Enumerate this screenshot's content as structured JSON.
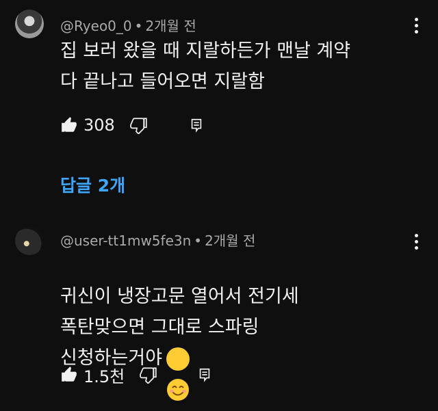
{
  "comments": [
    {
      "author": "@Ryeo0_0",
      "separator": "•",
      "time": "2개월 전",
      "text": "집 보러 왔을 때 지랄하든가 맨날 계약\n다 끝나고 들어오면 지랄함",
      "likes": "308"
    },
    {
      "author": "@user-tt1mw5fe3n",
      "separator": "•",
      "time": "2개월 전",
      "text": "귀신이 냉장고문 열어서 전기세\n폭탄맞으면 그대로 스파링\n신청하는거야",
      "emoji": "smiling-face-emoji",
      "likes": "1.5천"
    }
  ],
  "replies_label": "답글 2개",
  "colors": {
    "background": "#0f0f0f",
    "meta_text": "#aaaaaa",
    "primary_text": "#f1f1f1",
    "link": "#3ea6ff"
  },
  "icons": [
    "thumbs-up-icon",
    "thumbs-down-icon",
    "reply-icon",
    "more-vert-icon"
  ]
}
